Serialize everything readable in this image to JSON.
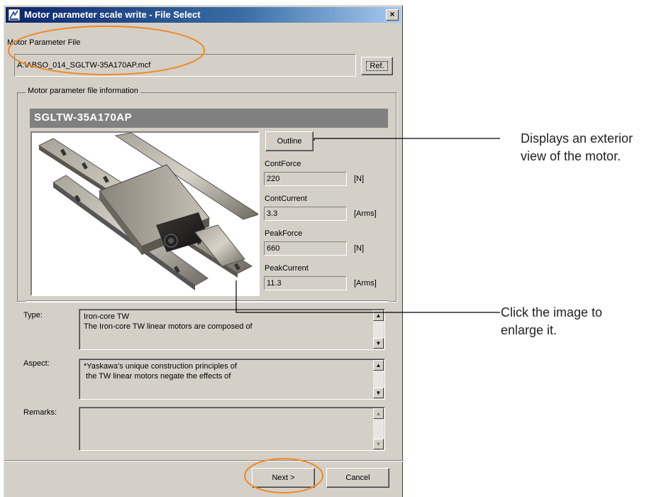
{
  "window": {
    "title": "Motor parameter scale write - File Select",
    "close_label": "×"
  },
  "file_section": {
    "label": "Motor Parameter File",
    "value": "A:\\ABSO_014_SGLTW-35A170AP.mcf",
    "ref_label": "Ref."
  },
  "info_group": {
    "title": "Motor parameter file information",
    "model": "SGLTW-35A170AP",
    "image_icon": "linear-motor-photo",
    "outline_label": "Outline",
    "params": [
      {
        "label": "ContForce",
        "value": "220",
        "unit": "[N]"
      },
      {
        "label": "ContCurrent",
        "value": "3.3",
        "unit": "[Arms]"
      },
      {
        "label": "PeakForce",
        "value": "660",
        "unit": "[N]"
      },
      {
        "label": "PeakCurrent",
        "value": "11.3",
        "unit": "[Arms]"
      }
    ]
  },
  "details": {
    "type_label": "Type:",
    "type_line1": "Iron-core TW",
    "type_line2": "The Iron-core TW linear motors are composed of",
    "aspect_label": "Aspect:",
    "aspect_line1": "*Yaskawa's unique construction principles of",
    "aspect_line2": " the TW linear motors negate the effects of",
    "remarks_label": "Remarks:",
    "remarks_value": ""
  },
  "footer": {
    "next_label": "Next >",
    "cancel_label": "Cancel"
  },
  "annotations": {
    "outline_line1": "Displays an exterior",
    "outline_line2": "view of the motor.",
    "image_line1": "Click the image to",
    "image_line2": "enlarge it."
  },
  "colors": {
    "highlight": "#f08a24",
    "dialog_bg": "#d4d0c8",
    "title_start": "#0a246a",
    "title_end": "#a6caf0"
  }
}
